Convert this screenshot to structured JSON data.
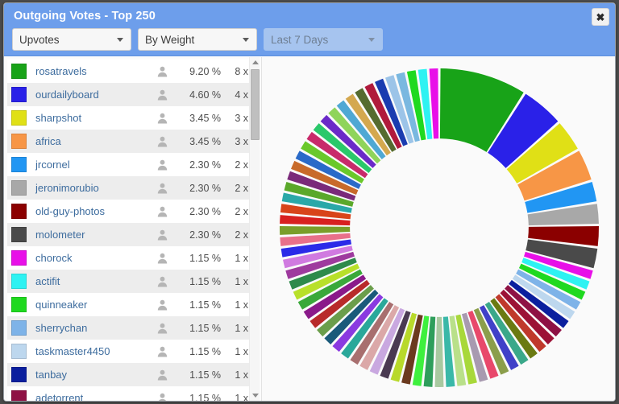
{
  "window": {
    "title": "Outgoing Votes - Top 250",
    "close_label": "✖"
  },
  "controls": {
    "vote_type": {
      "label": "Upvotes",
      "icon": "chevron-down-icon"
    },
    "sort_by": {
      "label": "By Weight",
      "icon": "chevron-down-icon"
    },
    "period": {
      "label": "Last 7 Days",
      "icon": "chevron-down-icon",
      "disabled": true
    }
  },
  "list": {
    "avatar_icon": "person-icon",
    "rows": [
      {
        "color": "#18a318",
        "name": "rosatravels",
        "pct": "9.20 %",
        "count": "8 x"
      },
      {
        "color": "#2a21e8",
        "name": "ourdailyboard",
        "pct": "4.60 %",
        "count": "4 x"
      },
      {
        "color": "#e0e016",
        "name": "sharpshot",
        "pct": "3.45 %",
        "count": "3 x"
      },
      {
        "color": "#f79646",
        "name": "africa",
        "pct": "3.45 %",
        "count": "3 x"
      },
      {
        "color": "#2196f3",
        "name": "jrcornel",
        "pct": "2.30 %",
        "count": "2 x"
      },
      {
        "color": "#a8a8a8",
        "name": "jeronimorubio",
        "pct": "2.30 %",
        "count": "2 x"
      },
      {
        "color": "#8b0000",
        "name": "old-guy-photos",
        "pct": "2.30 %",
        "count": "2 x"
      },
      {
        "color": "#4a4a4a",
        "name": "molometer",
        "pct": "2.30 %",
        "count": "2 x"
      },
      {
        "color": "#e810e8",
        "name": "chorock",
        "pct": "1.15 %",
        "count": "1 x"
      },
      {
        "color": "#2ef2f2",
        "name": "actifit",
        "pct": "1.15 %",
        "count": "1 x"
      },
      {
        "color": "#1fd91f",
        "name": "quinneaker",
        "pct": "1.15 %",
        "count": "1 x"
      },
      {
        "color": "#7eb3e8",
        "name": "sherrychan",
        "pct": "1.15 %",
        "count": "1 x"
      },
      {
        "color": "#bdd7ee",
        "name": "taskmaster4450",
        "pct": "1.15 %",
        "count": "1 x"
      },
      {
        "color": "#0b1f9e",
        "name": "tanbay",
        "pct": "1.15 %",
        "count": "1 x"
      },
      {
        "color": "#8e1144",
        "name": "adetorrent",
        "pct": "1.15 %",
        "count": "1 x"
      }
    ]
  },
  "chart_data": {
    "type": "pie",
    "title": "Outgoing Votes - Top 250",
    "variant": "donut",
    "start_angle_deg": 0,
    "direction": "clockwise",
    "inner_radius_ratio": 0.56,
    "legend": "left-list",
    "labels": [
      "rosatravels",
      "ourdailyboard",
      "sharpshot",
      "africa",
      "jrcornel",
      "jeronimorubio",
      "old-guy-photos",
      "molometer",
      "chorock",
      "actifit",
      "quinneaker",
      "sherrychan",
      "taskmaster4450",
      "tanbay",
      "adetorrent"
    ],
    "values": [
      9.2,
      4.6,
      3.45,
      3.45,
      2.3,
      2.3,
      2.3,
      2.3,
      1.15,
      1.15,
      1.15,
      1.15,
      1.15,
      1.15,
      1.15
    ],
    "unit": "%",
    "slices": [
      {
        "label": "rosatravels",
        "value": 9.2,
        "color": "#18a318"
      },
      {
        "label": "ourdailyboard",
        "value": 4.6,
        "color": "#2a21e8"
      },
      {
        "label": "sharpshot",
        "value": 3.45,
        "color": "#e0e016"
      },
      {
        "label": "africa",
        "value": 3.45,
        "color": "#f79646"
      },
      {
        "label": "jrcornel",
        "value": 2.3,
        "color": "#2196f3"
      },
      {
        "label": "jeronimorubio",
        "value": 2.3,
        "color": "#a8a8a8"
      },
      {
        "label": "old-guy-photos",
        "value": 2.3,
        "color": "#8b0000"
      },
      {
        "label": "molometer",
        "value": 2.3,
        "color": "#4a4a4a"
      },
      {
        "label": "chorock",
        "value": 1.15,
        "color": "#e810e8"
      },
      {
        "label": "actifit",
        "value": 1.15,
        "color": "#2ef2f2"
      },
      {
        "label": "quinneaker",
        "value": 1.15,
        "color": "#1fd91f"
      },
      {
        "label": "sherrychan",
        "value": 1.15,
        "color": "#7eb3e8"
      },
      {
        "label": "taskmaster4450",
        "value": 1.15,
        "color": "#bdd7ee"
      },
      {
        "label": "tanbay",
        "value": 1.15,
        "color": "#0b1f9e"
      },
      {
        "label": "adetorrent",
        "value": 1.15,
        "color": "#8e1144"
      },
      {
        "label": "",
        "value": 1.15,
        "color": "#9c1236"
      },
      {
        "label": "",
        "value": 1.15,
        "color": "#c0392b"
      },
      {
        "label": "",
        "value": 1.15,
        "color": "#6b7a12"
      },
      {
        "label": "",
        "value": 1.15,
        "color": "#3aa88a"
      },
      {
        "label": "",
        "value": 1.15,
        "color": "#4040c8"
      },
      {
        "label": "",
        "value": 1.15,
        "color": "#8b9e4b"
      },
      {
        "label": "",
        "value": 1.15,
        "color": "#e8486b"
      },
      {
        "label": "",
        "value": 1.15,
        "color": "#a89ab0"
      },
      {
        "label": "",
        "value": 1.15,
        "color": "#a8d83a"
      },
      {
        "label": "",
        "value": 1.15,
        "color": "#b9e08a"
      },
      {
        "label": "",
        "value": 1.15,
        "color": "#3ab8a8"
      },
      {
        "label": "",
        "value": 1.15,
        "color": "#a8c9a0"
      },
      {
        "label": "",
        "value": 1.15,
        "color": "#2e9e5b"
      },
      {
        "label": "",
        "value": 1.15,
        "color": "#3ef03e"
      },
      {
        "label": "",
        "value": 1.15,
        "color": "#6b3a1f"
      },
      {
        "label": "",
        "value": 1.15,
        "color": "#b8d92a"
      },
      {
        "label": "",
        "value": 1.15,
        "color": "#4a3a52"
      },
      {
        "label": "",
        "value": 1.15,
        "color": "#c9a8e0"
      },
      {
        "label": "",
        "value": 1.15,
        "color": "#dba8a8"
      },
      {
        "label": "",
        "value": 1.15,
        "color": "#a86f6f"
      },
      {
        "label": "",
        "value": 1.15,
        "color": "#2aa89a"
      },
      {
        "label": "",
        "value": 1.15,
        "color": "#8a3ae0"
      },
      {
        "label": "",
        "value": 1.15,
        "color": "#1a5a7a"
      },
      {
        "label": "",
        "value": 1.15,
        "color": "#6b9e4b"
      },
      {
        "label": "",
        "value": 1.15,
        "color": "#b82a2a"
      },
      {
        "label": "",
        "value": 1.15,
        "color": "#8a1a8a"
      },
      {
        "label": "",
        "value": 1.15,
        "color": "#3aa83a"
      },
      {
        "label": "",
        "value": 1.15,
        "color": "#b8e02a"
      },
      {
        "label": "",
        "value": 1.15,
        "color": "#2e8a4b"
      },
      {
        "label": "",
        "value": 1.15,
        "color": "#9e3a9e"
      },
      {
        "label": "",
        "value": 1.15,
        "color": "#d07ae0"
      },
      {
        "label": "",
        "value": 1.15,
        "color": "#2a2ae8"
      },
      {
        "label": "",
        "value": 1.15,
        "color": "#e8708a"
      },
      {
        "label": "",
        "value": 1.15,
        "color": "#7a9e2a"
      },
      {
        "label": "",
        "value": 1.15,
        "color": "#d82020"
      },
      {
        "label": "",
        "value": 1.15,
        "color": "#d8441a"
      },
      {
        "label": "",
        "value": 1.15,
        "color": "#2aa8a8"
      },
      {
        "label": "",
        "value": 1.15,
        "color": "#5aa82a"
      },
      {
        "label": "",
        "value": 1.15,
        "color": "#7a2a7a"
      },
      {
        "label": "",
        "value": 1.15,
        "color": "#c86a2a"
      },
      {
        "label": "",
        "value": 1.15,
        "color": "#2a6ac8"
      },
      {
        "label": "",
        "value": 1.15,
        "color": "#6ac82a"
      },
      {
        "label": "",
        "value": 1.15,
        "color": "#c82a6a"
      },
      {
        "label": "",
        "value": 1.15,
        "color": "#2ac86a"
      },
      {
        "label": "",
        "value": 1.15,
        "color": "#6a2ac8"
      },
      {
        "label": "",
        "value": 1.15,
        "color": "#8fd45a"
      },
      {
        "label": "",
        "value": 1.15,
        "color": "#4fa8d4"
      },
      {
        "label": "",
        "value": 1.15,
        "color": "#d4a84f"
      },
      {
        "label": "",
        "value": 1.15,
        "color": "#556b2f"
      },
      {
        "label": "",
        "value": 1.15,
        "color": "#b01a3c"
      },
      {
        "label": "",
        "value": 1.15,
        "color": "#1a3cb0"
      },
      {
        "label": "",
        "value": 1.15,
        "color": "#9cc4e8"
      },
      {
        "label": "",
        "value": 1.15,
        "color": "#7ab8e0"
      },
      {
        "label": "",
        "value": 1.15,
        "color": "#1fd91f"
      },
      {
        "label": "",
        "value": 1.15,
        "color": "#2ef2f2"
      },
      {
        "label": "",
        "value": 1.15,
        "color": "#e810e8"
      }
    ]
  }
}
